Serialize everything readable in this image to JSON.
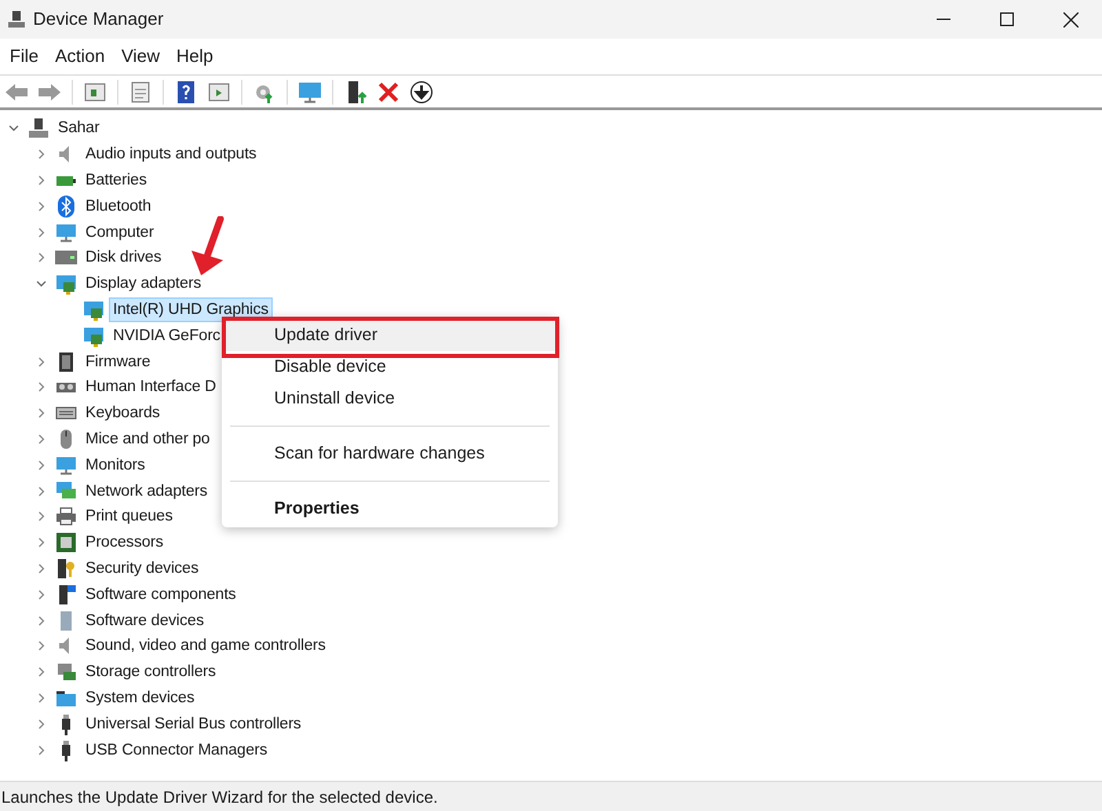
{
  "window": {
    "title": "Device Manager"
  },
  "menu_bar": [
    "File",
    "Action",
    "View",
    "Help"
  ],
  "tree": {
    "label": "Sahar",
    "expanded": true,
    "children": [
      {
        "label": "Audio inputs and outputs",
        "expanded": false,
        "selected": false
      },
      {
        "label": "Batteries",
        "expanded": false,
        "selected": false
      },
      {
        "label": "Bluetooth",
        "expanded": false,
        "selected": false
      },
      {
        "label": "Computer",
        "expanded": false,
        "selected": false
      },
      {
        "label": "Disk drives",
        "expanded": false,
        "selected": false
      },
      {
        "label": "Display adapters",
        "expanded": true,
        "selected": false,
        "children": [
          {
            "label": "Intel(R) UHD Graphics",
            "selected": true
          },
          {
            "label": "NVIDIA GeForc",
            "selected": false
          }
        ]
      },
      {
        "label": "Firmware",
        "expanded": false,
        "selected": false
      },
      {
        "label": "Human Interface D",
        "expanded": false,
        "selected": false
      },
      {
        "label": "Keyboards",
        "expanded": false,
        "selected": false
      },
      {
        "label": "Mice and other po",
        "expanded": false,
        "selected": false
      },
      {
        "label": "Monitors",
        "expanded": false,
        "selected": false
      },
      {
        "label": "Network adapters",
        "expanded": false,
        "selected": false
      },
      {
        "label": "Print queues",
        "expanded": false,
        "selected": false
      },
      {
        "label": "Processors",
        "expanded": false,
        "selected": false
      },
      {
        "label": "Security devices",
        "expanded": false,
        "selected": false
      },
      {
        "label": "Software components",
        "expanded": false,
        "selected": false
      },
      {
        "label": "Software devices",
        "expanded": false,
        "selected": false
      },
      {
        "label": "Sound, video and game controllers",
        "expanded": false,
        "selected": false
      },
      {
        "label": "Storage controllers",
        "expanded": false,
        "selected": false
      },
      {
        "label": "System devices",
        "expanded": false,
        "selected": false
      },
      {
        "label": "Universal Serial Bus controllers",
        "expanded": false,
        "selected": false
      },
      {
        "label": "USB Connector Managers",
        "expanded": false,
        "selected": false
      }
    ]
  },
  "context_menu": [
    {
      "kind": "item",
      "label": "Update driver",
      "selected": true,
      "bold": false
    },
    {
      "kind": "item",
      "label": "Disable device",
      "selected": false,
      "bold": false
    },
    {
      "kind": "item",
      "label": "Uninstall device",
      "selected": false,
      "bold": false
    },
    {
      "kind": "separator"
    },
    {
      "kind": "item",
      "label": "Scan for hardware changes",
      "selected": false,
      "bold": false
    },
    {
      "kind": "separator"
    },
    {
      "kind": "item",
      "label": "Properties",
      "selected": false,
      "bold": true
    }
  ],
  "status_bar": "Launches the Update Driver Wizard for the selected device."
}
